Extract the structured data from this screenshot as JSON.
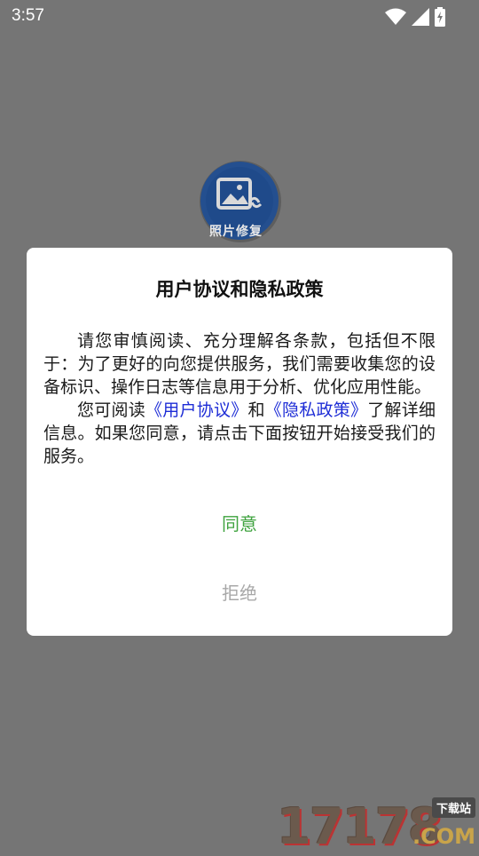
{
  "status_bar": {
    "time": "3:57",
    "icons": [
      "wifi-icon",
      "cell-signal-icon",
      "battery-charging-icon"
    ]
  },
  "app": {
    "logo_text": "照片修复"
  },
  "dialog": {
    "title": "用户协议和隐私政策",
    "paragraph1": "请您审慎阅读、充分理解各条款，包括但不限于：为了更好的向您提供服务，我们需要收集您的设备标识、操作日志等信息用于分析、优化应用性能。",
    "paragraph2_prefix": "您可阅读",
    "user_agreement_link": "《用户协议》",
    "and": "和",
    "privacy_policy_link": "《隐私政策》",
    "paragraph2_suffix": "了解详细信息。如果您同意，请点击下面按钮开始接受我们的服务。",
    "agree_label": "同意",
    "reject_label": "拒绝"
  },
  "watermark": {
    "number": "17178",
    "tag": "下载站",
    "domain": ".COM"
  },
  "colors": {
    "overlay": "#757575",
    "agree": "#3fa33f",
    "reject": "#a8a8a8",
    "link": "#1e2dd6"
  }
}
